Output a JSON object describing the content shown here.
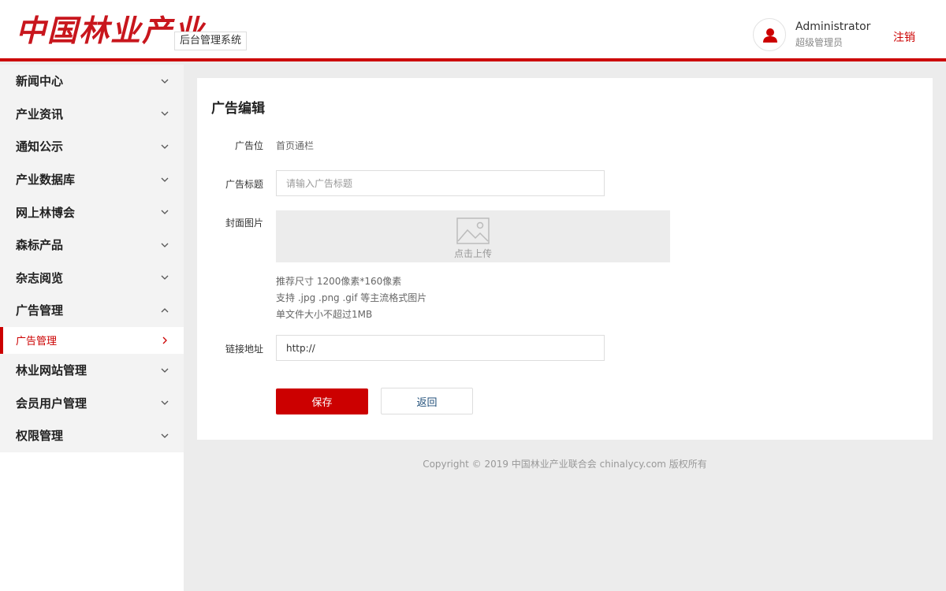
{
  "header": {
    "logo_text": "中国林业产业",
    "system_tag": "后台管理系统",
    "user_name": "Administrator",
    "user_role": "超级管理员",
    "logout_label": "注销"
  },
  "sidebar": {
    "items": [
      {
        "label": "新闻中心",
        "state": "collapsed"
      },
      {
        "label": "产业资讯",
        "state": "collapsed"
      },
      {
        "label": "通知公示",
        "state": "collapsed"
      },
      {
        "label": "产业数据库",
        "state": "collapsed"
      },
      {
        "label": "网上林博会",
        "state": "collapsed"
      },
      {
        "label": "森标产品",
        "state": "collapsed"
      },
      {
        "label": "杂志阅览",
        "state": "collapsed"
      },
      {
        "label": "广告管理",
        "state": "expanded"
      },
      {
        "label": "林业网站管理",
        "state": "collapsed"
      },
      {
        "label": "会员用户管理",
        "state": "collapsed"
      },
      {
        "label": "权限管理",
        "state": "collapsed"
      }
    ],
    "active_sub": {
      "label": "广告管理"
    }
  },
  "main": {
    "title": "广告编辑",
    "form": {
      "position_label": "广告位",
      "position_value": "首页通栏",
      "title_label": "广告标题",
      "title_placeholder": "请输入广告标题",
      "title_value": "",
      "cover_label": "封面图片",
      "upload_text": "点击上传",
      "hints": [
        "推荐尺寸 1200像素*160像素",
        "支持 .jpg .png .gif 等主流格式图片",
        "单文件大小不超过1MB"
      ],
      "link_label": "链接地址",
      "link_value": "http://"
    },
    "save_label": "保存",
    "back_label": "返回"
  },
  "footer": {
    "copyright": "Copyright © 2019 中国林业产业联合会 chinalycy.com 版权所有"
  },
  "colors": {
    "brand_red": "#cc0000",
    "sidebar_bg": "#f3f3f3",
    "page_bg": "#ececec"
  }
}
